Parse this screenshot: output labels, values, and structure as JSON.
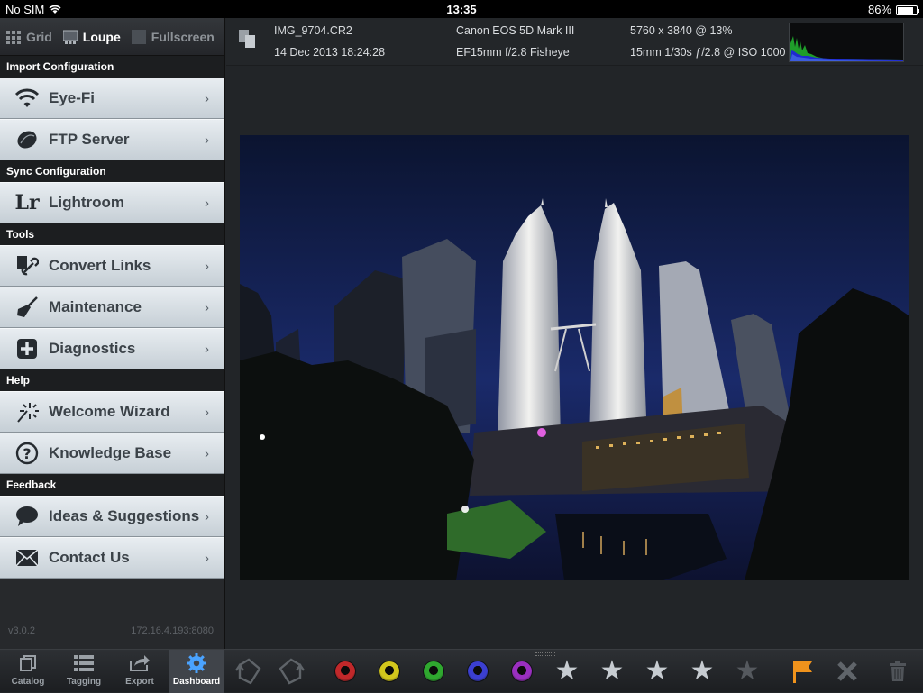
{
  "status": {
    "carrier": "No SIM",
    "time": "13:35",
    "battery": "86%",
    "battery_level": 0.86
  },
  "viewtabs": [
    {
      "label": "Grid",
      "active": false
    },
    {
      "label": "Loupe",
      "active": true
    },
    {
      "label": "Fullscreen",
      "active": false
    }
  ],
  "sidebar": {
    "sections": [
      {
        "title": "Import Configuration",
        "items": [
          {
            "label": "Eye-Fi",
            "icon": "wifi-icon"
          },
          {
            "label": "FTP Server",
            "icon": "ftp-disc-icon"
          }
        ]
      },
      {
        "title": "Sync Configuration",
        "items": [
          {
            "label": "Lightroom",
            "icon": "lightroom-icon"
          }
        ]
      },
      {
        "title": "Tools",
        "items": [
          {
            "label": "Convert Links",
            "icon": "link-convert-icon"
          },
          {
            "label": "Maintenance",
            "icon": "broom-icon"
          },
          {
            "label": "Diagnostics",
            "icon": "plus-box-icon"
          }
        ]
      },
      {
        "title": "Help",
        "items": [
          {
            "label": "Welcome Wizard",
            "icon": "wand-icon"
          },
          {
            "label": "Knowledge Base",
            "icon": "question-icon"
          }
        ]
      },
      {
        "title": "Feedback",
        "items": [
          {
            "label": "Ideas & Suggestions",
            "icon": "speech-bubble-icon"
          },
          {
            "label": "Contact Us",
            "icon": "envelope-icon"
          }
        ]
      }
    ],
    "lr_glyph": "Lr",
    "version": "v3.0.2",
    "ip": "172.16.4.193:8080"
  },
  "info": {
    "filename": "IMG_9704.CR2",
    "date": "14 Dec 2013 18:24:28",
    "camera": "Canon EOS 5D Mark III",
    "lens": "EF15mm f/2.8 Fisheye",
    "dimensions": "5760 x 3840 @ 13%",
    "exposure": "15mm 1/30s ƒ/2.8 @ ISO 1000"
  },
  "bottom_tabs": [
    {
      "label": "Catalog",
      "icon": "catalog-icon",
      "active": false
    },
    {
      "label": "Tagging",
      "icon": "list-icon",
      "active": false
    },
    {
      "label": "Export",
      "icon": "export-icon",
      "active": false
    },
    {
      "label": "Dashboard",
      "icon": "gear-icon",
      "active": true
    }
  ],
  "color_labels": [
    {
      "name": "red",
      "color": "#c0282a"
    },
    {
      "name": "yellow",
      "color": "#d2c61c"
    },
    {
      "name": "green",
      "color": "#2fa82f"
    },
    {
      "name": "blue",
      "color": "#3b3fd0"
    },
    {
      "name": "purple",
      "color": "#9a2fc0"
    }
  ],
  "rating": {
    "stars_filled": 4,
    "stars_total": 5
  },
  "colors": {
    "accent": "#4aa3ff",
    "flag": "#f0931c"
  }
}
